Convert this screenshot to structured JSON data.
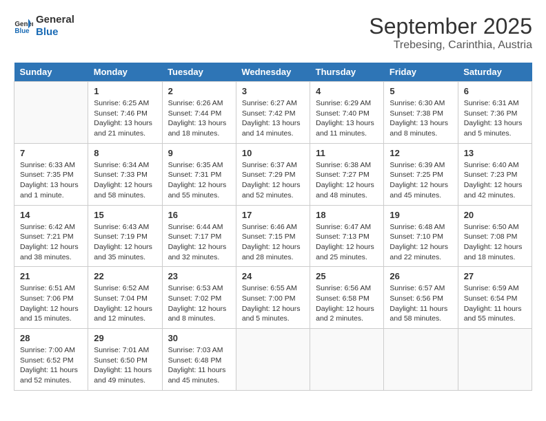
{
  "header": {
    "logo_line1": "General",
    "logo_line2": "Blue",
    "month": "September 2025",
    "location": "Trebesing, Carinthia, Austria"
  },
  "days_of_week": [
    "Sunday",
    "Monday",
    "Tuesday",
    "Wednesday",
    "Thursday",
    "Friday",
    "Saturday"
  ],
  "weeks": [
    [
      {
        "day": "",
        "info": ""
      },
      {
        "day": "1",
        "info": "Sunrise: 6:25 AM\nSunset: 7:46 PM\nDaylight: 13 hours\nand 21 minutes."
      },
      {
        "day": "2",
        "info": "Sunrise: 6:26 AM\nSunset: 7:44 PM\nDaylight: 13 hours\nand 18 minutes."
      },
      {
        "day": "3",
        "info": "Sunrise: 6:27 AM\nSunset: 7:42 PM\nDaylight: 13 hours\nand 14 minutes."
      },
      {
        "day": "4",
        "info": "Sunrise: 6:29 AM\nSunset: 7:40 PM\nDaylight: 13 hours\nand 11 minutes."
      },
      {
        "day": "5",
        "info": "Sunrise: 6:30 AM\nSunset: 7:38 PM\nDaylight: 13 hours\nand 8 minutes."
      },
      {
        "day": "6",
        "info": "Sunrise: 6:31 AM\nSunset: 7:36 PM\nDaylight: 13 hours\nand 5 minutes."
      }
    ],
    [
      {
        "day": "7",
        "info": "Sunrise: 6:33 AM\nSunset: 7:35 PM\nDaylight: 13 hours\nand 1 minute."
      },
      {
        "day": "8",
        "info": "Sunrise: 6:34 AM\nSunset: 7:33 PM\nDaylight: 12 hours\nand 58 minutes."
      },
      {
        "day": "9",
        "info": "Sunrise: 6:35 AM\nSunset: 7:31 PM\nDaylight: 12 hours\nand 55 minutes."
      },
      {
        "day": "10",
        "info": "Sunrise: 6:37 AM\nSunset: 7:29 PM\nDaylight: 12 hours\nand 52 minutes."
      },
      {
        "day": "11",
        "info": "Sunrise: 6:38 AM\nSunset: 7:27 PM\nDaylight: 12 hours\nand 48 minutes."
      },
      {
        "day": "12",
        "info": "Sunrise: 6:39 AM\nSunset: 7:25 PM\nDaylight: 12 hours\nand 45 minutes."
      },
      {
        "day": "13",
        "info": "Sunrise: 6:40 AM\nSunset: 7:23 PM\nDaylight: 12 hours\nand 42 minutes."
      }
    ],
    [
      {
        "day": "14",
        "info": "Sunrise: 6:42 AM\nSunset: 7:21 PM\nDaylight: 12 hours\nand 38 minutes."
      },
      {
        "day": "15",
        "info": "Sunrise: 6:43 AM\nSunset: 7:19 PM\nDaylight: 12 hours\nand 35 minutes."
      },
      {
        "day": "16",
        "info": "Sunrise: 6:44 AM\nSunset: 7:17 PM\nDaylight: 12 hours\nand 32 minutes."
      },
      {
        "day": "17",
        "info": "Sunrise: 6:46 AM\nSunset: 7:15 PM\nDaylight: 12 hours\nand 28 minutes."
      },
      {
        "day": "18",
        "info": "Sunrise: 6:47 AM\nSunset: 7:13 PM\nDaylight: 12 hours\nand 25 minutes."
      },
      {
        "day": "19",
        "info": "Sunrise: 6:48 AM\nSunset: 7:10 PM\nDaylight: 12 hours\nand 22 minutes."
      },
      {
        "day": "20",
        "info": "Sunrise: 6:50 AM\nSunset: 7:08 PM\nDaylight: 12 hours\nand 18 minutes."
      }
    ],
    [
      {
        "day": "21",
        "info": "Sunrise: 6:51 AM\nSunset: 7:06 PM\nDaylight: 12 hours\nand 15 minutes."
      },
      {
        "day": "22",
        "info": "Sunrise: 6:52 AM\nSunset: 7:04 PM\nDaylight: 12 hours\nand 12 minutes."
      },
      {
        "day": "23",
        "info": "Sunrise: 6:53 AM\nSunset: 7:02 PM\nDaylight: 12 hours\nand 8 minutes."
      },
      {
        "day": "24",
        "info": "Sunrise: 6:55 AM\nSunset: 7:00 PM\nDaylight: 12 hours\nand 5 minutes."
      },
      {
        "day": "25",
        "info": "Sunrise: 6:56 AM\nSunset: 6:58 PM\nDaylight: 12 hours\nand 2 minutes."
      },
      {
        "day": "26",
        "info": "Sunrise: 6:57 AM\nSunset: 6:56 PM\nDaylight: 11 hours\nand 58 minutes."
      },
      {
        "day": "27",
        "info": "Sunrise: 6:59 AM\nSunset: 6:54 PM\nDaylight: 11 hours\nand 55 minutes."
      }
    ],
    [
      {
        "day": "28",
        "info": "Sunrise: 7:00 AM\nSunset: 6:52 PM\nDaylight: 11 hours\nand 52 minutes."
      },
      {
        "day": "29",
        "info": "Sunrise: 7:01 AM\nSunset: 6:50 PM\nDaylight: 11 hours\nand 49 minutes."
      },
      {
        "day": "30",
        "info": "Sunrise: 7:03 AM\nSunset: 6:48 PM\nDaylight: 11 hours\nand 45 minutes."
      },
      {
        "day": "",
        "info": ""
      },
      {
        "day": "",
        "info": ""
      },
      {
        "day": "",
        "info": ""
      },
      {
        "day": "",
        "info": ""
      }
    ]
  ]
}
